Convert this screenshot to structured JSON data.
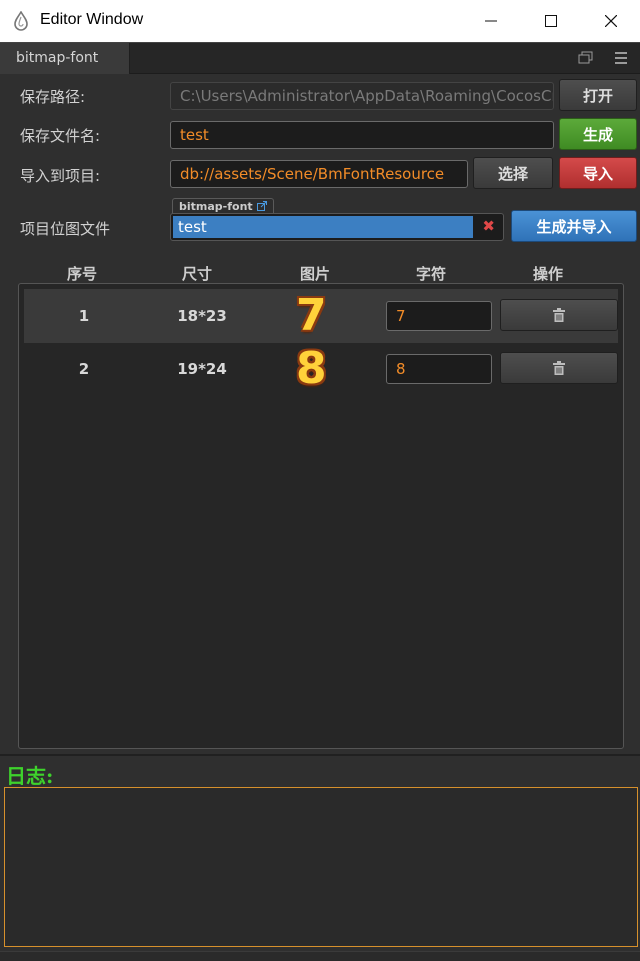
{
  "window": {
    "title": "Editor Window",
    "minimize_icon": "minimize-icon",
    "maximize_icon": "maximize-icon",
    "close_icon": "close-icon"
  },
  "tab": {
    "label": "bitmap-font"
  },
  "form": {
    "save_path": {
      "label": "保存路径:",
      "value": "C:\\Users\\Administrator\\AppData\\Roaming\\CocosCrea",
      "button": "打开"
    },
    "file_name": {
      "label": "保存文件名:",
      "value": "test",
      "button": "生成"
    },
    "import_to": {
      "label": "导入到项目:",
      "value": "db://assets/Scene/BmFontResource",
      "select_button": "选择",
      "import_button": "导入"
    },
    "project_bitmap": {
      "label": "项目位图文件",
      "asset_type": "bitmap-font",
      "asset_value": "test",
      "button": "生成并导入"
    }
  },
  "table": {
    "headers": [
      "序号",
      "尺寸",
      "图片",
      "字符",
      "操作"
    ],
    "rows": [
      {
        "index": "1",
        "size": "18*23",
        "glyph": "7",
        "char": "7"
      },
      {
        "index": "2",
        "size": "19*24",
        "glyph": "8",
        "char": "8"
      }
    ]
  },
  "log": {
    "title": "日志:"
  },
  "colors": {
    "accent_orange": "#f28c28",
    "log_green": "#3ed22c",
    "selection_blue": "#3c7fc2"
  }
}
